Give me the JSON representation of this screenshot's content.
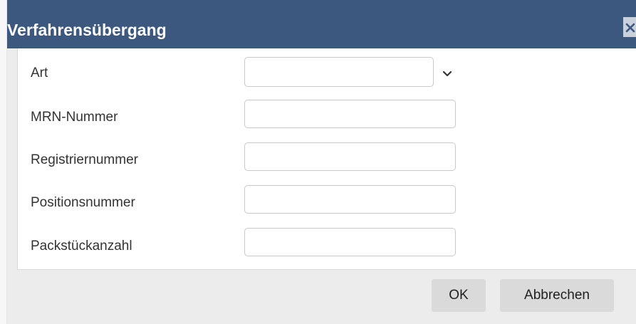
{
  "dialog": {
    "title": "Verfahrensübergang",
    "close_icon": "close-icon"
  },
  "form": {
    "fields": [
      {
        "label": "Art",
        "type": "select",
        "value": "",
        "icon": "chevron-down-icon"
      },
      {
        "label": "MRN-Nummer",
        "type": "text",
        "value": ""
      },
      {
        "label": "Registriernummer",
        "type": "text",
        "value": ""
      },
      {
        "label": "Positionsnummer",
        "type": "text",
        "value": ""
      },
      {
        "label": "Packstückanzahl",
        "type": "text",
        "value": ""
      }
    ]
  },
  "footer": {
    "ok_label": "OK",
    "cancel_label": "Abbrechen"
  },
  "colors": {
    "titlebar": "#3c587e",
    "dialog_bg": "#ececec",
    "content_bg": "#ffffff",
    "button_bg": "#dadada"
  }
}
